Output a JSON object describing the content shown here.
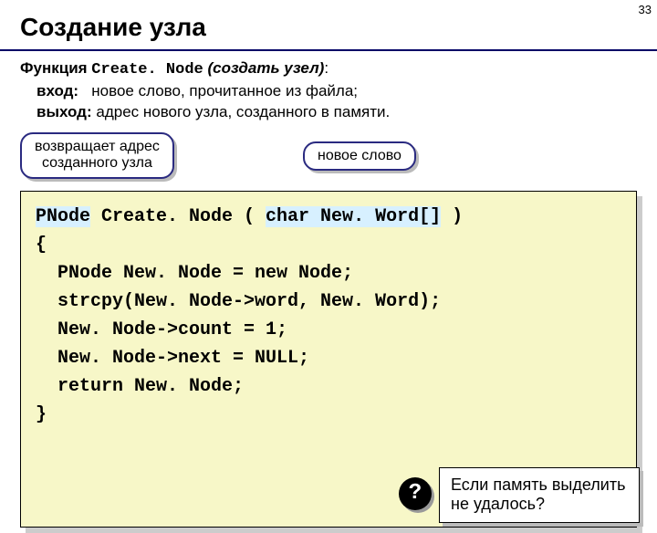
{
  "page_number": "33",
  "title": "Создание узла",
  "desc": {
    "func_label": "Функция",
    "func_name": "Create. Node",
    "func_hint": "(создать узел)",
    "colon": ":",
    "input_label": "вход:",
    "input_text": "новое слово, прочитанное из файла;",
    "output_label": "выход:",
    "output_text": "адрес нового узла, созданного в памяти."
  },
  "callouts": {
    "left_line1": "возвращает адрес",
    "left_line2": "созданного узла",
    "right": "новое слово"
  },
  "code": {
    "sig_ret": "PNode",
    "sig_mid": " Create. Node ( ",
    "sig_arg": "char New. Word[]",
    "sig_end": " )",
    "line_open": "{",
    "line1": "  PNode New. Node = new Node;",
    "line2": "  strcpy(New. Node->word, New. Word);",
    "line3": "  New. Node->count = 1;",
    "line4": "  New. Node->next = NULL;",
    "line5": "  return New. Node;",
    "line_close": "}"
  },
  "note": {
    "badge": "?",
    "text": "Если память выделить не удалось?"
  }
}
